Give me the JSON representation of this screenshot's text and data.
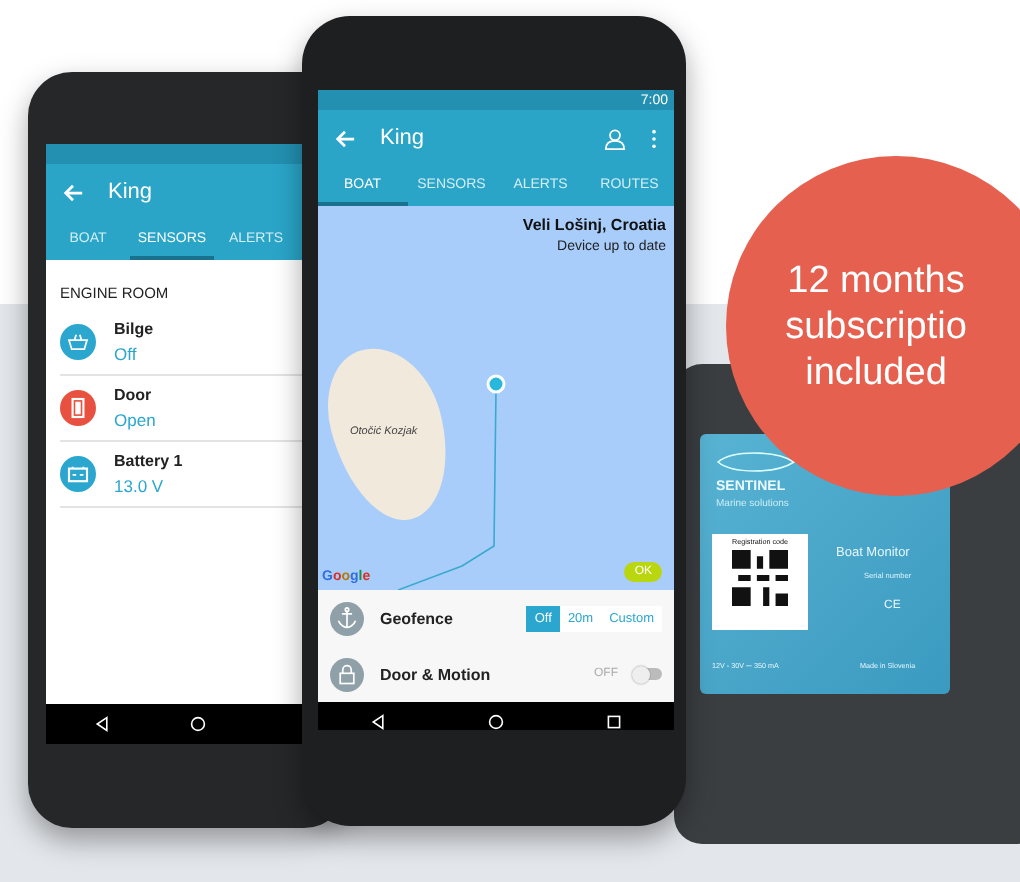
{
  "phone_left": {
    "app_bar": {
      "title": "King"
    },
    "tabs": [
      {
        "label": "BOAT",
        "selected": false
      },
      {
        "label": "SENSORS",
        "selected": true
      },
      {
        "label": "ALERTS",
        "selected": false
      }
    ],
    "section": "ENGINE ROOM",
    "sensors": [
      {
        "kind": "bilge",
        "name": "Bilge",
        "value": "Off",
        "color": "#2aa6cf"
      },
      {
        "kind": "door",
        "name": "Door",
        "value": "Open",
        "color": "#e8513f"
      },
      {
        "kind": "battery",
        "name": "Battery 1",
        "value": "13.0 V",
        "color": "#2aa6cf"
      }
    ]
  },
  "phone_right": {
    "status_time": "7:00",
    "app_bar": {
      "title": "King"
    },
    "tabs": [
      {
        "label": "BOAT",
        "selected": true
      },
      {
        "label": "SENSORS",
        "selected": false
      },
      {
        "label": "ALERTS",
        "selected": false
      },
      {
        "label": "ROUTES",
        "selected": false
      }
    ],
    "map": {
      "location": "Veli Lošinj, Croatia",
      "status": "Device up to date",
      "island_label": "Otočić Kozjak",
      "logo": "Google",
      "ok_button": "OK"
    },
    "settings": [
      {
        "kind": "segmented",
        "label": "Geofence",
        "options": [
          {
            "label": "Off",
            "selected": true
          },
          {
            "label": "20m",
            "selected": false
          },
          {
            "label": "Custom",
            "selected": false
          }
        ]
      },
      {
        "kind": "toggle",
        "label": "Door & Motion",
        "state_label": "OFF",
        "on": false
      }
    ]
  },
  "badge": {
    "lines": [
      "12 months",
      "subscriptio",
      "included"
    ]
  },
  "device": {
    "brand": "SENTINEL",
    "tagline": "Marine solutions",
    "registration_label": "Registration code",
    "product": "Boat Monitor",
    "serial_label": "Serial number",
    "certification": "CE",
    "rating": "12V - 30V ⎓ 350 mA",
    "origin": "Made in Slovenia"
  }
}
